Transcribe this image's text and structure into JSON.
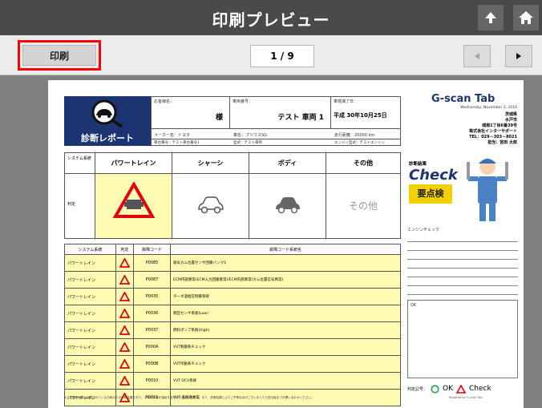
{
  "header": {
    "title": "印刷プレビュー",
    "up_icon": "up-arrow-icon",
    "home_icon": "home-icon"
  },
  "toolbar": {
    "print_label": "印刷",
    "page_indicator": "1 / 9",
    "prev_icon": "triangle-left-icon",
    "next_icon": "triangle-right-icon"
  },
  "report": {
    "badge_label": "診断レポート",
    "customer_label": "お客様名：",
    "customer_value": "様",
    "vehicle_label": "車両番号：",
    "vehicle_value": "テスト 車両 1",
    "registration_label": "車検満了日：",
    "registration_value": "平成 30年10月25日",
    "maker": "メーカー名：トヨタ",
    "car_name": "車名：プリウスSG",
    "mileage": "走行距離：20000 km",
    "chassis": "車台番号：テスト車台番号1",
    "model": "型式：テスト車両",
    "engine": "エンジン型式：テストエンジン",
    "logo": "G-scan Tab",
    "shop_date": "Wednesday, November 2, 2016",
    "shop_lines": [
      "茨城県",
      "水戸市",
      "城南1丁目6番39号",
      "株式会社インターサポート",
      "TEL：029－303－8021",
      "担当：宮田 太郎"
    ],
    "check_top": "診断結果",
    "check_word": "Check",
    "check_result": "要点検",
    "engine_check_label": "エンジンチェック",
    "comment": "OK",
    "legend_label": "判定記号：",
    "legend_ok": "OK",
    "legend_check": "Check",
    "footer_note": "※この診断結果は記載されている日時点での診断結果であり、今後の状態を保証するものではありません。また、診断結果によりご不明な点がございましたら担当者までお問い合わせください。",
    "footer_right": "Powered by G-scan Tab",
    "system": {
      "col_label": "システム系統",
      "row_label": "判定",
      "columns": [
        "パワートレイン",
        "シャーシ",
        "ボディ",
        "その他"
      ],
      "other_text": "その他"
    },
    "codes": {
      "headers": [
        "システム系統",
        "判定",
        "故障コード",
        "故障コード系統名"
      ],
      "rows": [
        [
          "パワートレイン",
          "P0085",
          "吸気カム位置センサ回路バンク1"
        ],
        [
          "パワートレイン",
          "P0087",
          "ECM内部異常(ECM入力回路異常)/ECM内部異常(カム位置信号異常)"
        ],
        [
          "パワートレイン",
          "P0035",
          "ターボ過給圧制御系統"
        ],
        [
          "パワートレイン",
          "P0036",
          "燃圧センサ系統(Low)"
        ],
        [
          "パワートレイン",
          "P0037",
          "燃料ポンプ系統(High)"
        ],
        [
          "パワートレイン",
          "P000A",
          "VVT制御系チェック"
        ],
        [
          "パワートレイン",
          "P000B",
          "VVT作動系チェック"
        ],
        [
          "パワートレイン",
          "P0010",
          "VVT OCV系統"
        ],
        [
          "パワートレイン",
          "P0011",
          "VVT 進角系異常"
        ]
      ]
    }
  },
  "colors": {
    "topbar": "#4a4a4a",
    "highlight": "#ff0000",
    "navy": "#1c3572",
    "yellow": "#fffbb3"
  }
}
